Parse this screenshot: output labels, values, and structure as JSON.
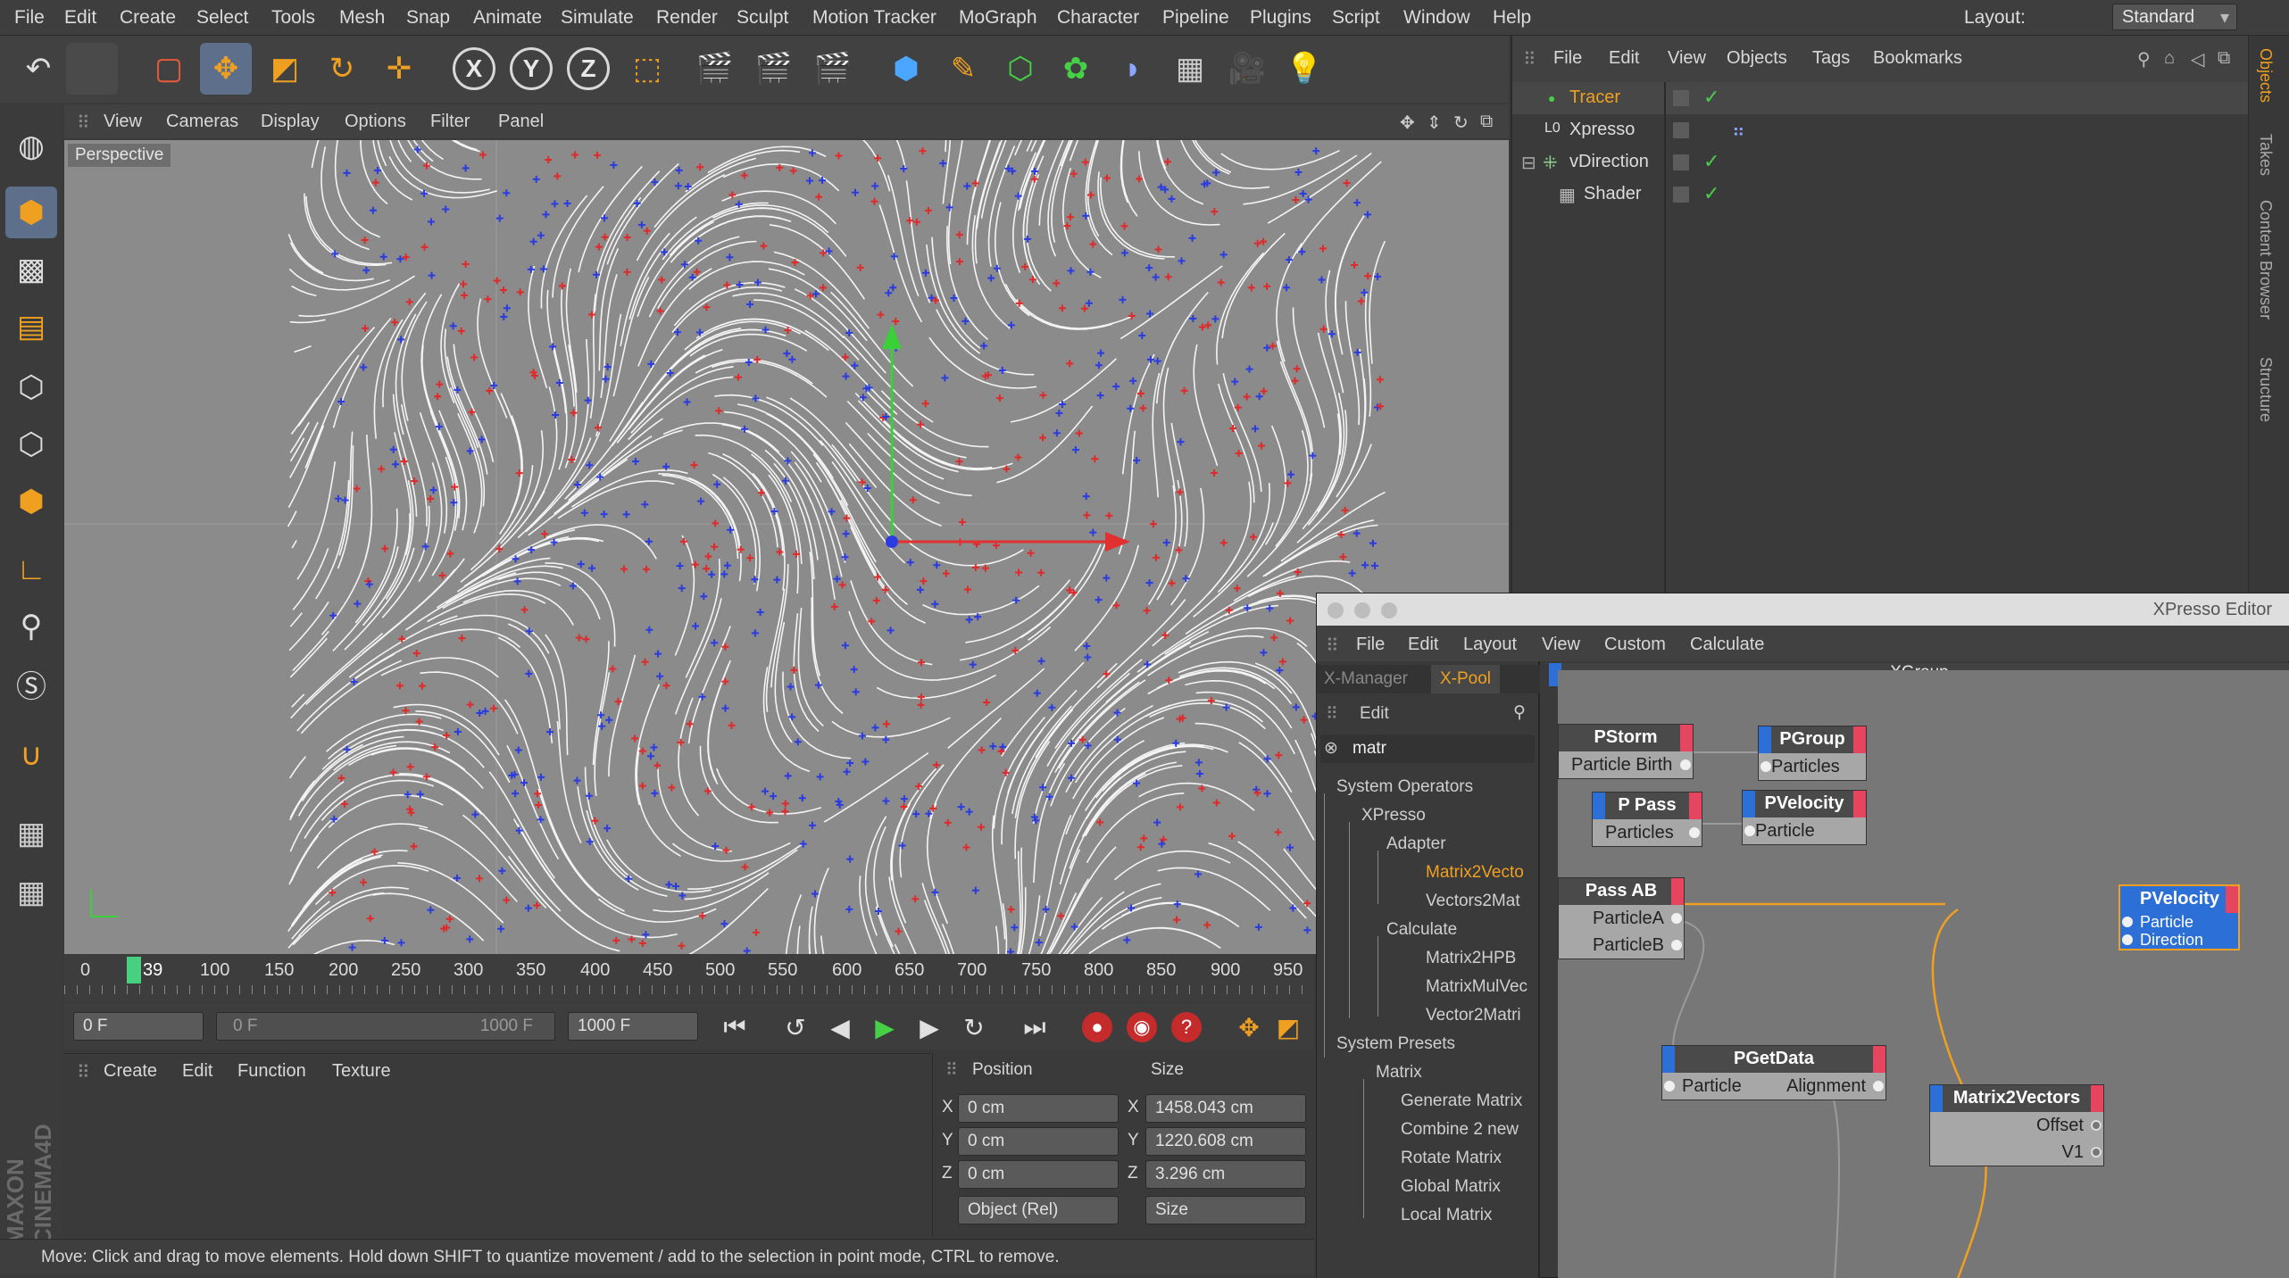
{
  "menubar": {
    "items": [
      "File",
      "Edit",
      "Create",
      "Select",
      "Tools",
      "Mesh",
      "Snap",
      "Animate",
      "Simulate",
      "Render",
      "Sculpt",
      "Motion Tracker",
      "MoGraph",
      "Character",
      "Pipeline",
      "Plugins",
      "Script",
      "Window",
      "Help"
    ],
    "layout_label": "Layout:",
    "layout_value": "Standard"
  },
  "toolbar": {
    "axes": [
      "X",
      "Y",
      "Z"
    ]
  },
  "viewport": {
    "menu": [
      "View",
      "Cameras",
      "Display",
      "Options",
      "Filter",
      "Panel"
    ],
    "label": "Perspective"
  },
  "timeline": {
    "ticks": [
      "0",
      "100",
      "150",
      "200",
      "250",
      "300",
      "350",
      "400",
      "450",
      "500",
      "550",
      "600",
      "650",
      "700",
      "750",
      "800",
      "850",
      "900",
      "950"
    ],
    "current": "39"
  },
  "transport": {
    "start": "0 F",
    "range_start": "0 F",
    "range_end": "1000 F",
    "end": "1000 F"
  },
  "material": {
    "menu": [
      "Create",
      "Edit",
      "Function",
      "Texture"
    ]
  },
  "coords": {
    "position_header": "Position",
    "size_header": "Size",
    "axes": [
      "X",
      "Y",
      "Z"
    ],
    "positions": [
      "0 cm",
      "0 cm",
      "0 cm"
    ],
    "sizes": [
      "1458.043 cm",
      "1220.608 cm",
      "3.296 cm"
    ],
    "mode": "Object (Rel)",
    "size_mode": "Size"
  },
  "status": "Move: Click and drag to move elements. Hold down SHIFT to quantize movement / add to the selection in point mode, CTRL to remove.",
  "objects": {
    "menu": [
      "File",
      "Edit",
      "View",
      "Objects",
      "Tags",
      "Bookmarks"
    ],
    "items": [
      "Tracer",
      "Xpresso",
      "vDirection",
      "Shader"
    ]
  },
  "sidetabs": [
    "Objects",
    "Takes",
    "Content Browser",
    "Structure"
  ],
  "xpresso": {
    "title": "XPresso Editor",
    "menu": [
      "File",
      "Edit",
      "Layout",
      "View",
      "Custom",
      "Calculate"
    ],
    "tabs": [
      "X-Manager",
      "X-Pool"
    ],
    "pool_edit": "Edit",
    "search": "matr",
    "tree": [
      "System Operators",
      "XPresso",
      "Adapter",
      "Matrix2Vecto",
      "Vectors2Mat",
      "Calculate",
      "Matrix2HPB",
      "MatrixMulVec",
      "Vector2Matri",
      "System Presets",
      "Matrix",
      "Generate Matrix",
      "Combine 2 new",
      "Rotate Matrix",
      "Global Matrix",
      "Local Matrix"
    ],
    "group": "XGroup",
    "nodes": {
      "pstorm": {
        "title": "PStorm",
        "ports": [
          "Particle Birth"
        ]
      },
      "pgroup": {
        "title": "PGroup",
        "ports": [
          "Particles"
        ]
      },
      "ppass": {
        "title": "P Pass",
        "ports": [
          "Particles"
        ]
      },
      "pvelocity1": {
        "title": "PVelocity",
        "ports": [
          "Particle"
        ]
      },
      "passab": {
        "title": "Pass AB",
        "ports": [
          "ParticleA",
          "ParticleB"
        ]
      },
      "pvelocity2": {
        "title": "PVelocity",
        "ports": [
          "Particle",
          "Direction"
        ]
      },
      "pgetdata": {
        "title": "PGetData",
        "ports": [
          "Particle",
          "Alignment"
        ]
      },
      "matrix2vectors": {
        "title": "Matrix2Vectors",
        "ports": [
          "Offset",
          "V1"
        ]
      }
    }
  },
  "colors": {
    "accent_orange": "#f0a020",
    "selection_blue": "#5d6f8b",
    "node_red": "#e6455f",
    "node_blue": "#2c6fd6"
  }
}
